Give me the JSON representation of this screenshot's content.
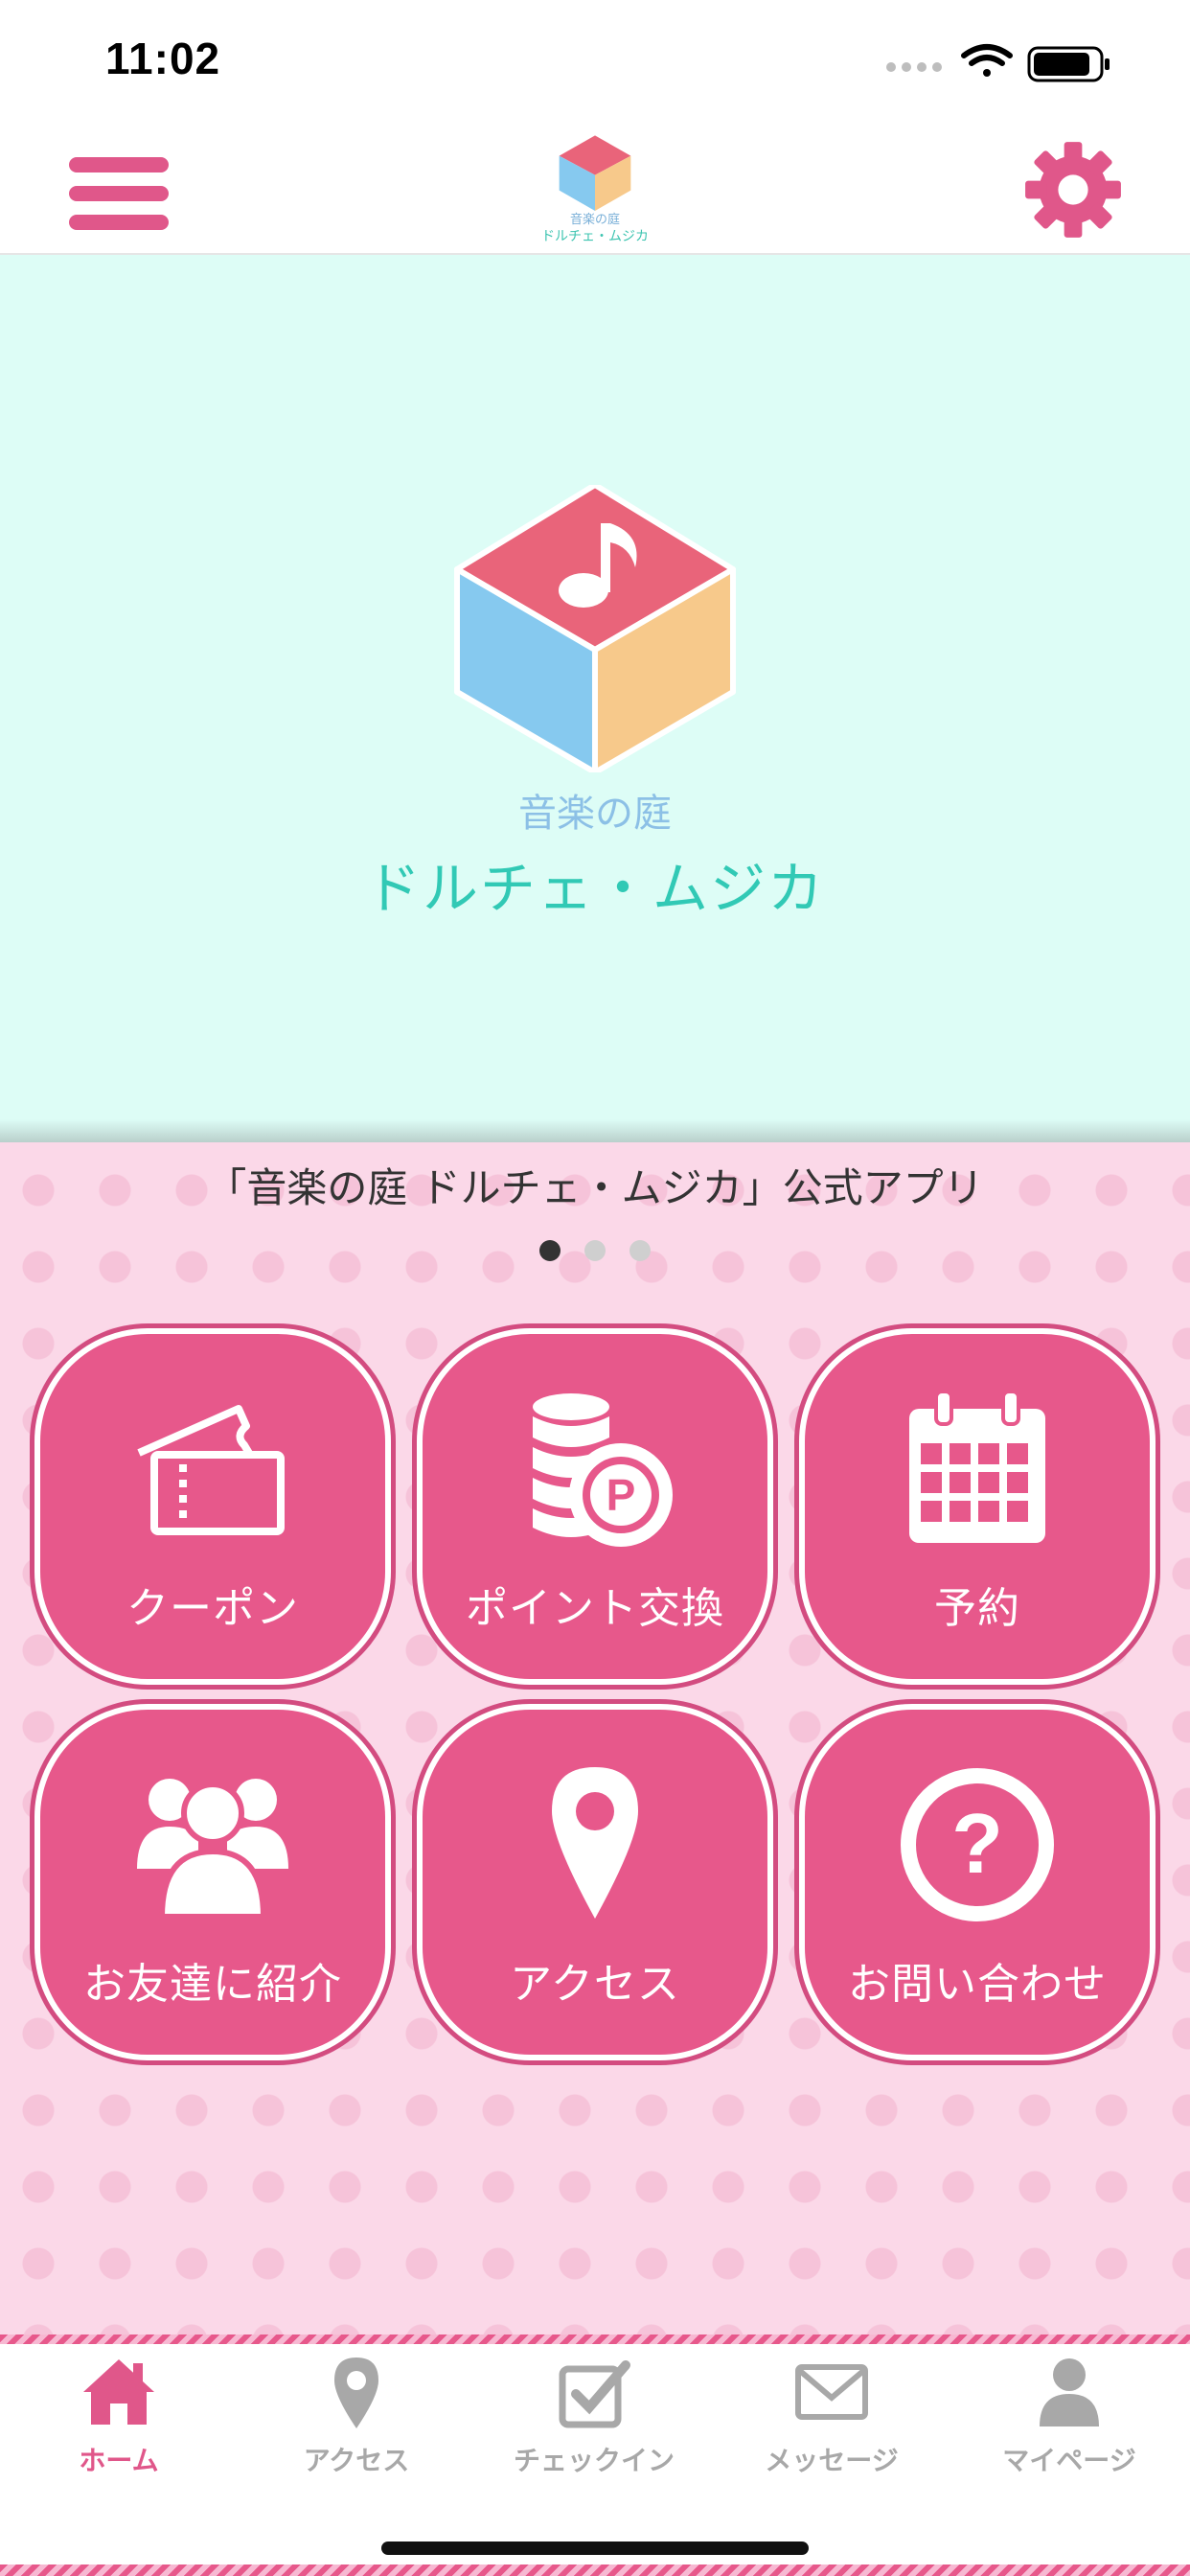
{
  "status": {
    "time": "11:02"
  },
  "header": {
    "logo_line1": "音楽の庭",
    "logo_line2": "ドルチェ・ムジカ"
  },
  "hero": {
    "subtitle": "音楽の庭",
    "title": "ドルチェ・ムジカ"
  },
  "caption": "「音楽の庭 ドルチェ・ムジカ」公式アプリ",
  "carousel": {
    "page_count": 3,
    "active_index": 0
  },
  "tiles": [
    {
      "label": "クーポン",
      "icon": "ticket-icon"
    },
    {
      "label": "ポイント交換",
      "icon": "coins-icon"
    },
    {
      "label": "予約",
      "icon": "calendar-icon"
    },
    {
      "label": "お友達に紹介",
      "icon": "group-icon"
    },
    {
      "label": "アクセス",
      "icon": "map-pin-icon"
    },
    {
      "label": "お問い合わせ",
      "icon": "question-icon"
    }
  ],
  "tabbar": [
    {
      "label": "ホーム",
      "icon": "home-icon",
      "active": true
    },
    {
      "label": "アクセス",
      "icon": "map-pin-icon",
      "active": false
    },
    {
      "label": "チェックイン",
      "icon": "checkin-icon",
      "active": false
    },
    {
      "label": "メッセージ",
      "icon": "mail-icon",
      "active": false
    },
    {
      "label": "マイページ",
      "icon": "user-icon",
      "active": false
    }
  ],
  "colors": {
    "accent": "#e7588b",
    "hero_bg": "#ddfdf6",
    "pattern_bg": "#fbd8e8",
    "inactive": "#a8a8a8"
  }
}
